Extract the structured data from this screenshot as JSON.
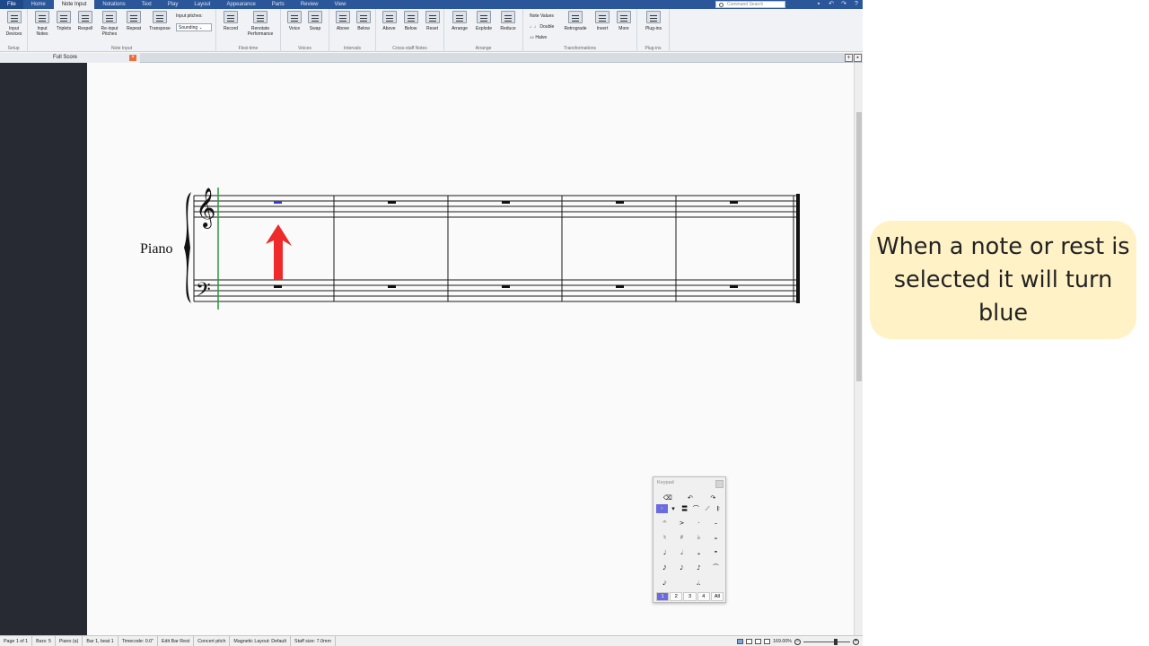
{
  "menu": {
    "tabs": [
      "File",
      "Home",
      "Note Input",
      "Notations",
      "Text",
      "Play",
      "Layout",
      "Appearance",
      "Parts",
      "Review",
      "View"
    ],
    "active": "Note Input",
    "command_search_placeholder": "Command Search"
  },
  "ribbon": {
    "groups": [
      {
        "name": "Setup",
        "buttons": [
          "Input Devices"
        ]
      },
      {
        "name": "Note Input",
        "buttons": [
          "Input Notes",
          "Triplets",
          "Respell",
          "Re-input Pitches",
          "Repeat",
          "Transpose"
        ]
      },
      {
        "name": "Flexi-time",
        "buttons": [
          "Record",
          "Renotate Performance"
        ]
      },
      {
        "name": "Voices",
        "buttons": [
          "Voice",
          "Swap"
        ]
      },
      {
        "name": "Intervals",
        "buttons": [
          "Above",
          "Below"
        ]
      },
      {
        "name": "Cross-staff Notes",
        "buttons": [
          "Above",
          "Below",
          "Reset"
        ]
      },
      {
        "name": "Arrange",
        "buttons": [
          "Arrange",
          "Explode",
          "Reduce"
        ]
      },
      {
        "name": "Transformations",
        "buttons": [
          "Retrograde",
          "Invert",
          "More"
        ]
      },
      {
        "name": "Plug-ins",
        "buttons": [
          "Plug-ins"
        ]
      }
    ],
    "input_pitches_label": "Input pitches:",
    "input_pitches_value": "Sounding",
    "note_values_label": "Note Values",
    "double_label": "Double",
    "halve_label": "Halve"
  },
  "document_tab": {
    "title": "Full Score",
    "close_glyph": "×"
  },
  "score": {
    "instrument": "Piano",
    "bars": 5,
    "selected_rest_color": "#3a3ad6",
    "staff_line_color": "#1a1a1a",
    "caret_color": "#2a9a3a",
    "annotation_arrow_color": "#ee2a2a"
  },
  "status_bar": {
    "items": [
      "Page 1 of 1",
      "Bars: 5",
      "Piano (a)",
      "Bar 1, beat 1",
      "Timecode: 0.0\"",
      "Edit Bar Rest",
      "Concert pitch",
      "Magnetic Layout: Default",
      "Staff size: 7.0mm"
    ],
    "zoom": "169.00%"
  },
  "keypad": {
    "title": "Keypad",
    "top_row": [
      "⌫",
      "↶",
      "↷"
    ],
    "row_articulations": [
      "◦",
      "▾",
      "〓",
      "⌒",
      "⟋",
      "𝄆"
    ],
    "row_accents": [
      "𝄐",
      ">",
      "·",
      "–"
    ],
    "row_accidentals": [
      "♮",
      "♯",
      "♭",
      "𝄪"
    ],
    "row_notes": [
      "♩",
      "𝅗𝅥",
      "𝅝",
      "𝄺"
    ],
    "row_notes2": [
      "𝅘𝅥𝅯",
      "𝅘𝅥𝅮",
      "♪",
      "⁀"
    ],
    "row_misc": [
      "𝅘𝅥𝄾",
      "",
      "𝅗𝅥.",
      ""
    ],
    "tabs": [
      "1",
      "2",
      "3",
      "4",
      "All"
    ],
    "active_tab": "1"
  },
  "callout": {
    "text": "When a note or rest is selected it will turn blue",
    "background": "#fff2c6"
  }
}
